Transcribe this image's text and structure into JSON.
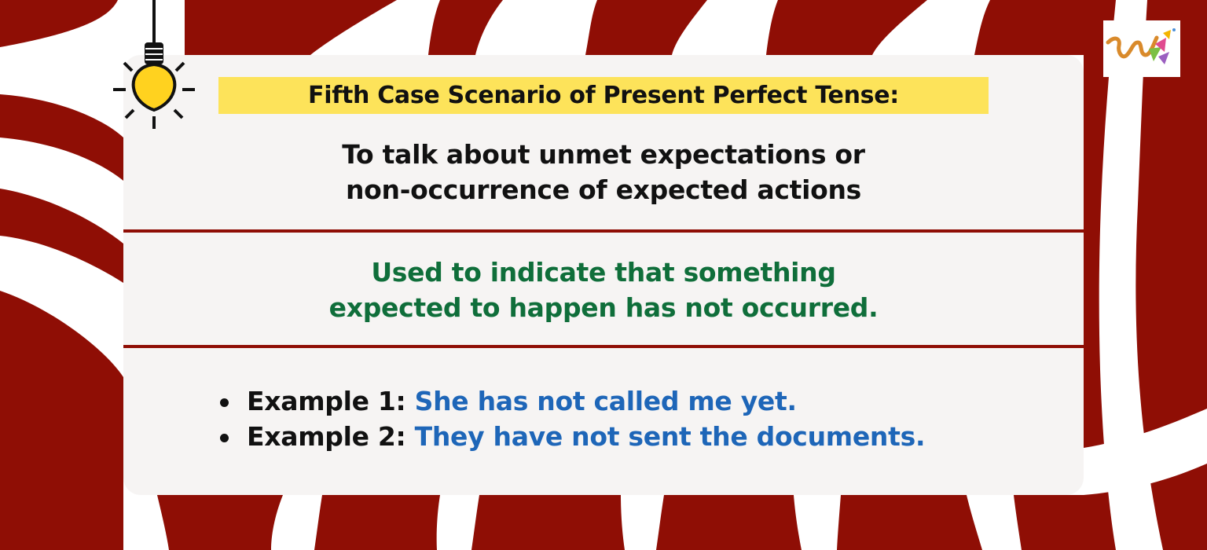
{
  "colors": {
    "maroon": "#8f0e05",
    "card": "#f6f4f3",
    "highlight": "#fde35a",
    "green_text": "#0f6e3a",
    "blue_text": "#1e66b8",
    "bulb": "#ffd21f"
  },
  "icons": {
    "bulb": "light-bulb-icon",
    "logo": "w-logo-icon"
  },
  "title": "Fifth Case Scenario of Present Perfect Tense:",
  "subtitle": {
    "line1": "To talk about unmet expectations or",
    "line2": "non-occurrence of expected actions"
  },
  "description": {
    "line1": "Used to indicate that something",
    "line2": "expected to happen has not occurred."
  },
  "examples": [
    {
      "label": "Example 1:",
      "text": "She has not called me yet."
    },
    {
      "label": "Example 2:",
      "text": "They have not sent the documents."
    }
  ]
}
